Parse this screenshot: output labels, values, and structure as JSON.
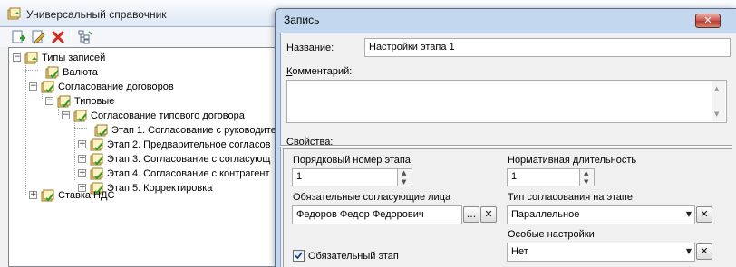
{
  "left_window": {
    "title": "Универсальный справочник",
    "toolbar": {
      "add_icon": "add-record-icon",
      "edit_icon": "edit-record-icon",
      "delete_icon": "delete-icon",
      "tree_view_icon": "tree-view-icon"
    },
    "tree": {
      "root": "Типы записей",
      "currency": "Валюта",
      "contracts": "Согласование договоров",
      "typical": "Типовые",
      "typical_contract": "Согласование типового договора",
      "stage1": "Этап 1. Согласование с руководите",
      "stage2": "Этап 2. Предварительное согласов",
      "stage3": "Этап 3. Согласование с согласующ",
      "stage4": "Этап 4. Согласование с контрагент",
      "stage5": "Этап 5. Корректировка",
      "vat": "Ставка НДС"
    }
  },
  "dialog": {
    "title": "Запись",
    "close_label": "✕",
    "name_label_u": "Н",
    "name_label_rest": "азвание:",
    "name_value": "Настройки этапа 1",
    "comment_label_u": "К",
    "comment_label_rest": "омментарий:",
    "comment_value": "",
    "properties_label_u": "С",
    "properties_label_rest": "войства:",
    "properties": {
      "stage_number_label": "Порядковый номер этапа",
      "stage_number_value": "1",
      "duration_label": "Нормативная длительность",
      "duration_value": "1",
      "approvers_label": "Обязательные согласующие лица",
      "approvers_value": "Федоров Федор Федорович",
      "browse_label": "...",
      "clear_label": "✕",
      "approval_type_label": "Тип согласования на этапе",
      "approval_type_value": "Параллельное",
      "special_label": "Особые настройки",
      "special_value": "Нет",
      "mandatory_label": "Обязательный этап",
      "mandatory_checked": true
    }
  }
}
